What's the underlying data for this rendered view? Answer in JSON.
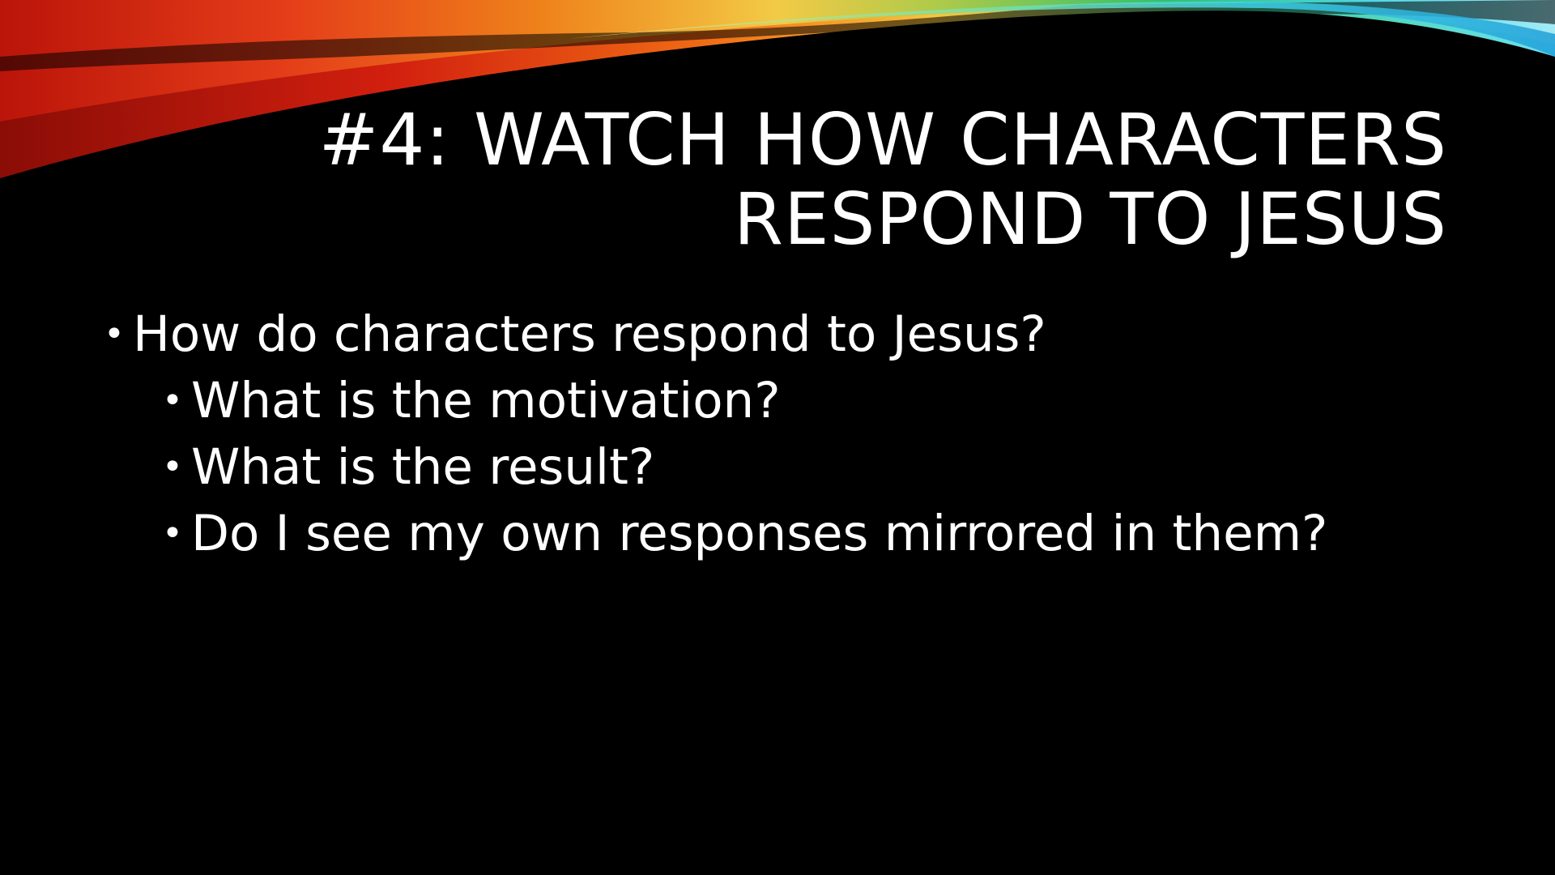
{
  "slide": {
    "title_lines": [
      "#4: Watch how characters",
      "respond to Jesus"
    ],
    "bullets": [
      {
        "level": 1,
        "text": "How do characters respond to Jesus?"
      },
      {
        "level": 2,
        "text": "What is the motivation?"
      },
      {
        "level": 2,
        "text": "What is the result?"
      },
      {
        "level": 2,
        "text": "Do I see my own responses mirrored in them?"
      }
    ],
    "bullet_glyph": "•"
  },
  "colors": {
    "background": "#000000",
    "text": "#ffffff",
    "swoosh_red": "#d21f0f",
    "swoosh_orange": "#f08a1c",
    "swoosh_yellow": "#f2d24a",
    "swoosh_green": "#2bbf6a",
    "swoosh_cyan": "#4fd6e8"
  }
}
